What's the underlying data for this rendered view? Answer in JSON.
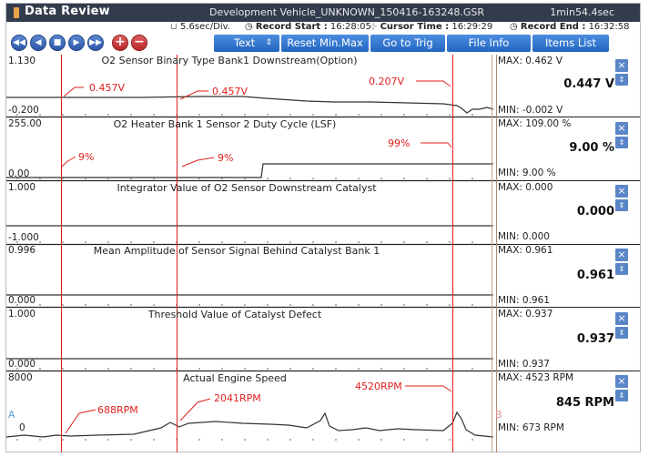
{
  "window": {
    "title": "Data Review",
    "file": "Development Vehicle_UNKNOWN_150416-163248.GSR",
    "duration": "1min54.4sec"
  },
  "infobar": {
    "div": "5.6sec/Div.",
    "record_start_label": "Record Start :",
    "record_start": "16:28:05",
    "cursor_time_label": "Cursor Time :",
    "cursor_time": "16:29:29",
    "record_end_label": "Record End :",
    "record_end": "16:32:58"
  },
  "toolbar": {
    "rewind": "◀◀",
    "back": "◀",
    "stop": "■",
    "forward": "▶",
    "fast_forward": "▶▶",
    "zoom_in": "+",
    "zoom_out": "−",
    "text": "Text",
    "select_arrows": "⇕",
    "reset": "Reset Min.Max",
    "go_trig": "Go to Trig",
    "file_info": "File Info",
    "items_list": "Items List"
  },
  "panels": [
    {
      "title": "O2 Sensor Binary Type Bank1 Downstream(Option)",
      "ymax": "1.130",
      "ymin": "-0.200",
      "max": "MAX: 0.462 V",
      "current": "0.447 V",
      "min": "MIN: -0.002 V"
    },
    {
      "title": "O2 Heater Bank 1 Sensor 2 Duty Cycle (LSF)",
      "ymax": "255.00",
      "ymin": "0.00",
      "max": "MAX: 109.00 %",
      "current": "9.00 %",
      "min": "MIN: 9.00 %"
    },
    {
      "title": "Integrator Value of O2 Sensor Downstream Catalyst",
      "ymax": "1.000",
      "ymin": "-1.000",
      "max": "MAX: 0.000",
      "current": "0.000",
      "min": "MIN: 0.000"
    },
    {
      "title": "Mean Amplitude of Sensor Signal Behind Catalyst Bank 1",
      "ymax": "0.996",
      "ymin": "0.000",
      "max": "MAX: 0.961",
      "current": "0.961",
      "min": "MIN: 0.961"
    },
    {
      "title": "Threshold Value of Catalyst Defect",
      "ymax": "1.000",
      "ymin": "0.000",
      "max": "MAX: 0.937",
      "current": "0.937",
      "min": "MIN: 0.937"
    },
    {
      "title": "Actual Engine Speed",
      "ymax": "8000",
      "ymin": "0",
      "max": "MAX:  4523 RPM",
      "current": "845 RPM",
      "min": "MIN:  673 RPM"
    }
  ],
  "annotations": {
    "p1": [
      "0.457V",
      "0.457V",
      "0.207V"
    ],
    "p2": [
      "9%",
      "9%",
      "99%"
    ],
    "p6": [
      "688RPM",
      "2041RPM",
      "4520RPM"
    ]
  },
  "markers": {
    "a": "A",
    "b": "B"
  },
  "icons": {
    "close": "×",
    "scroll": "⇕"
  },
  "colors": {
    "titlebar": "#333c4d",
    "button": "#2d6fc9",
    "marker": "#e0201e",
    "cursor_b": "#c8a68c"
  }
}
